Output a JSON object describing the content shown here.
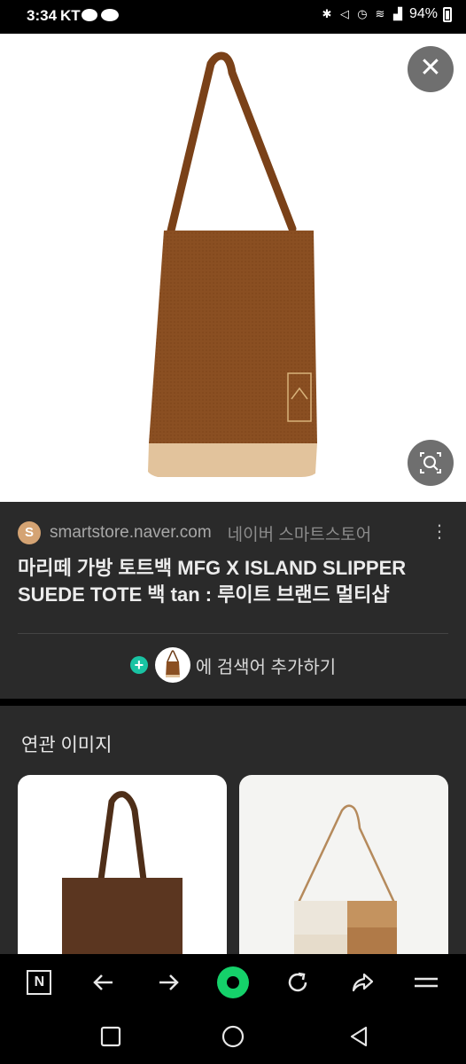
{
  "status_bar": {
    "time": "3:34",
    "carrier": "KT",
    "battery": "94%"
  },
  "viewer": {
    "close_icon": "close-icon",
    "lens_icon": "image-search-icon"
  },
  "result": {
    "favicon_letter": "S",
    "domain": "smartstore.naver.com",
    "site_name": "네이버 스마트스토어",
    "more_icon": "more-vertical-icon",
    "title": "마리떼 가방 토트백 MFG X ISLAND SLIPPER SUEDE TOTE 백 tan : 루이트 브랜드 멀티샵",
    "add_search_label": "에 검색어 추가하기"
  },
  "related": {
    "title": "연관 이미지"
  },
  "toolbar": {
    "n_label": "N",
    "items": [
      "naver-home-icon",
      "back-arrow-icon",
      "forward-arrow-icon",
      "green-dot-icon",
      "refresh-icon",
      "share-icon",
      "menu-icon"
    ]
  },
  "colors": {
    "panel": "#2a2a2a",
    "accent_green": "#15d16a",
    "plus_teal": "#19c3a3",
    "bag_brown": "#8a4f22",
    "bag_tan": "#e2c39c"
  }
}
